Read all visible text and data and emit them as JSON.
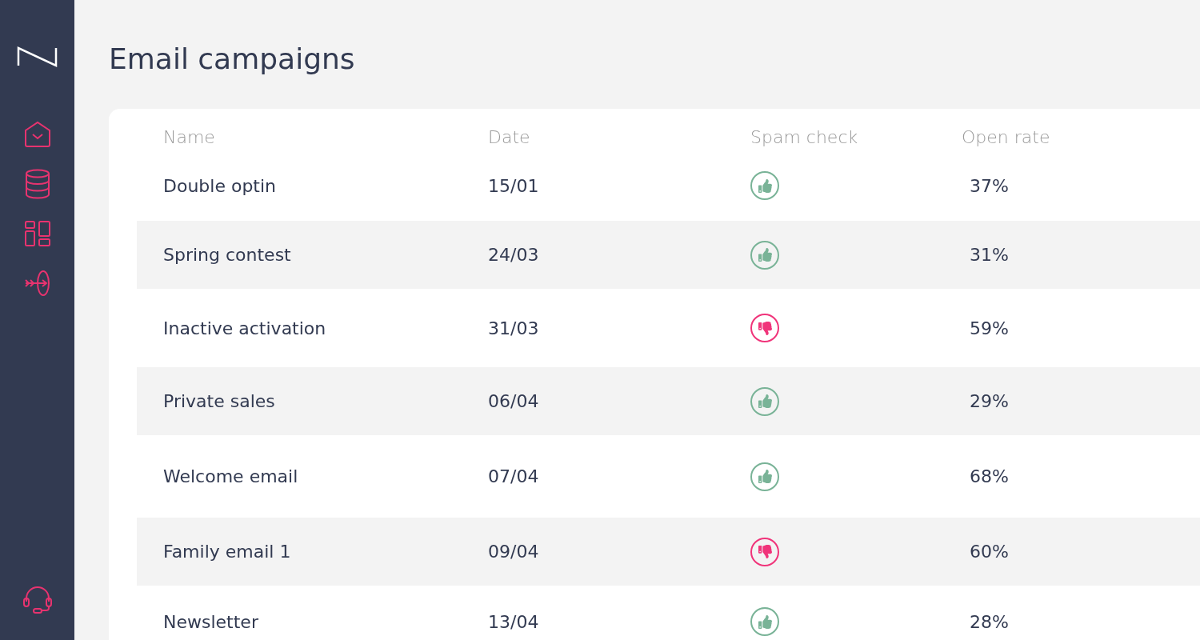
{
  "page_title": "Email campaigns",
  "table": {
    "columns": [
      "Name",
      "Date",
      "Spam check",
      "Open rate"
    ],
    "rows": [
      {
        "name": "Double optin",
        "date": "15/01",
        "spam_passed": true,
        "open_rate": "37%"
      },
      {
        "name": "Spring contest",
        "date": "24/03",
        "spam_passed": true,
        "open_rate": "31%"
      },
      {
        "name": "Inactive activation",
        "date": "31/03",
        "spam_passed": false,
        "open_rate": "59%"
      },
      {
        "name": "Private sales",
        "date": "06/04",
        "spam_passed": true,
        "open_rate": "29%"
      },
      {
        "name": "Welcome email",
        "date": "07/04",
        "spam_passed": true,
        "open_rate": "68%"
      },
      {
        "name": "Family email 1",
        "date": "09/04",
        "spam_passed": false,
        "open_rate": "60%"
      },
      {
        "name": "Newsletter",
        "date": "13/04",
        "spam_passed": true,
        "open_rate": "28%"
      }
    ]
  }
}
